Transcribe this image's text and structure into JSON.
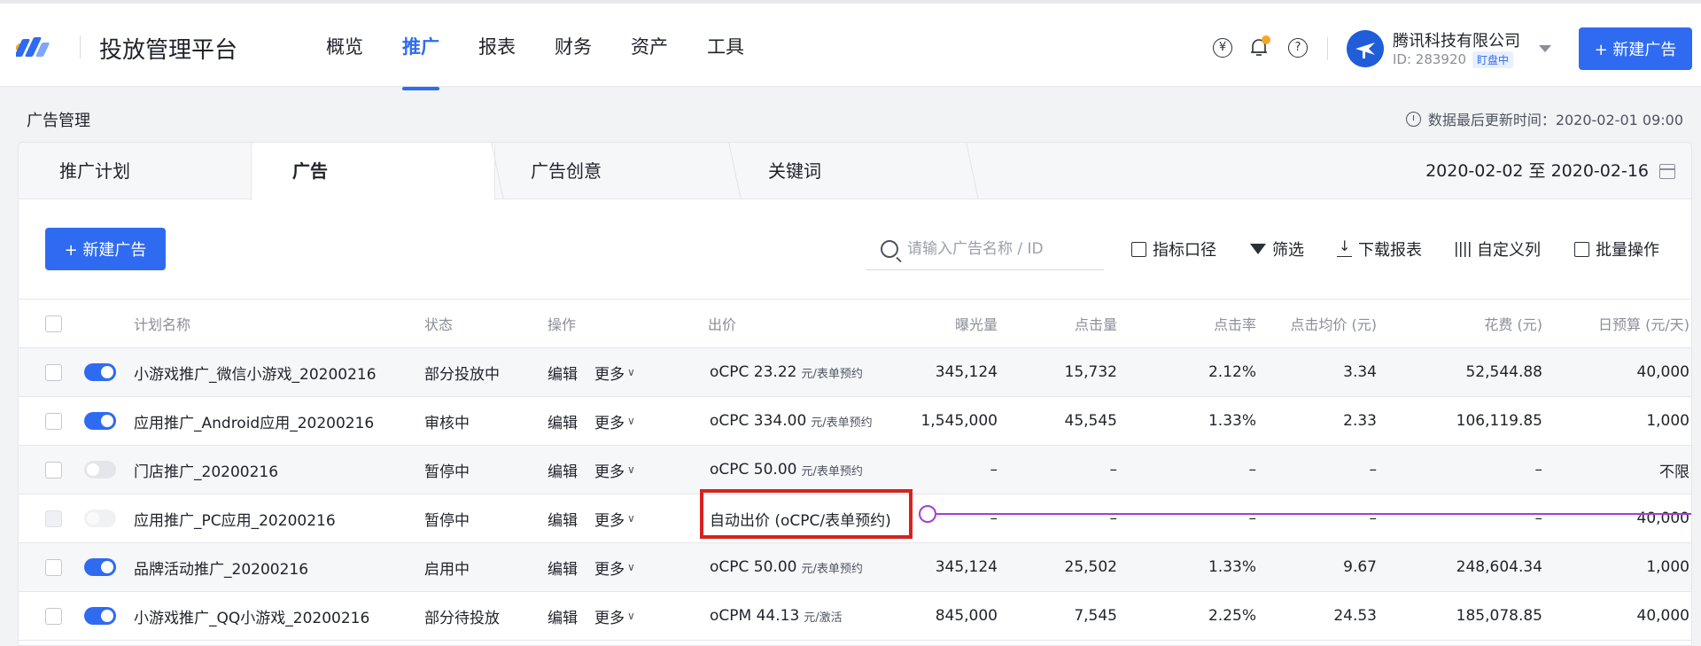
{
  "app": {
    "title": "投放管理平台"
  },
  "nav": [
    {
      "label": "概览",
      "active": false
    },
    {
      "label": "推广",
      "active": true
    },
    {
      "label": "报表",
      "active": false
    },
    {
      "label": "财务",
      "active": false
    },
    {
      "label": "资产",
      "active": false
    },
    {
      "label": "工具",
      "active": false
    }
  ],
  "header_icons": [
    "yuan-icon",
    "bell-icon",
    "help-icon"
  ],
  "account": {
    "company": "腾讯科技有限公司",
    "id": "ID: 283920",
    "badge": "盯盘中"
  },
  "header_button": "+ 新建广告",
  "page": {
    "title": "广告管理",
    "update_time": "数据最后更新时间：2020-02-01 09:00"
  },
  "tabs": [
    {
      "label": "推广计划",
      "active": false
    },
    {
      "label": "广告",
      "active": true
    },
    {
      "label": "广告创意",
      "active": false
    },
    {
      "label": "关键词",
      "active": false
    }
  ],
  "date_range": "2020-02-02 至 2020-02-16",
  "toolbar": {
    "new_button": "+ 新建广告",
    "search_placeholder": "请输入广告名称 / ID",
    "tools": [
      "指标口径",
      "筛选",
      "下载报表",
      "自定义列",
      "批量操作"
    ]
  },
  "table": {
    "columns": [
      "计划名称",
      "状态",
      "操作",
      "出价",
      "曝光量",
      "点击量",
      "点击率",
      "点击均价 (元)",
      "花费 (元)",
      "日预算 (元/天)"
    ],
    "rows": [
      {
        "name": "小游戏推广_微信小游戏_20200216",
        "status": "部分投放中",
        "edit": "编辑",
        "more": "更多",
        "bid": "oCPC 23.22",
        "bid_unit": "元/表单预约",
        "impressions": "345,124",
        "clicks": "15,732",
        "ctr": "2.12%",
        "cpc": "3.34",
        "cost": "52,544.88",
        "budget": "40,000",
        "switch": "on"
      },
      {
        "name": "应用推广_Android应用_20200216",
        "status": "审核中",
        "edit": "编辑",
        "more": "更多",
        "bid": "oCPC 334.00",
        "bid_unit": "元/表单预约",
        "impressions": "1,545,000",
        "clicks": "45,545",
        "ctr": "1.33%",
        "cpc": "2.33",
        "cost": "106,119.85",
        "budget": "1,000",
        "switch": "on"
      },
      {
        "name": "门店推广_20200216",
        "status": "暂停中",
        "edit": "编辑",
        "more": "更多",
        "bid": "oCPC 50.00",
        "bid_unit": "元/表单预约",
        "impressions": "–",
        "clicks": "–",
        "ctr": "–",
        "cpc": "–",
        "cost": "–",
        "budget": "不限",
        "switch": "off"
      },
      {
        "name": "应用推广_PC应用_20200216",
        "status": "暂停中",
        "edit": "编辑",
        "more": "更多",
        "bid": "自动出价 (oCPC/表单预约)",
        "bid_unit": "",
        "impressions": "–",
        "clicks": "–",
        "ctr": "–",
        "cpc": "–",
        "cost": "–",
        "budget": "40,000",
        "switch": "disabled"
      },
      {
        "name": "品牌活动推广_20200216",
        "status": "启用中",
        "edit": "编辑",
        "more": "更多",
        "bid": "oCPC 50.00",
        "bid_unit": "元/表单预约",
        "impressions": "345,124",
        "clicks": "25,502",
        "ctr": "1.33%",
        "cpc": "9.67",
        "cost": "248,604.34",
        "budget": "1,000",
        "switch": "on"
      },
      {
        "name": "小游戏推广_QQ小游戏_20200216",
        "status": "部分待投放",
        "edit": "编辑",
        "more": "更多",
        "bid": "oCPM 44.13",
        "bid_unit": "元/激活",
        "impressions": "845,000",
        "clicks": "7,545",
        "ctr": "2.25%",
        "cpc": "24.53",
        "cost": "185,078.85",
        "budget": "40,000",
        "switch": "on"
      }
    ]
  },
  "colors": {
    "primary": "#2f6bf1",
    "highlight": "#d5231f",
    "slider": "#a23fd1"
  }
}
